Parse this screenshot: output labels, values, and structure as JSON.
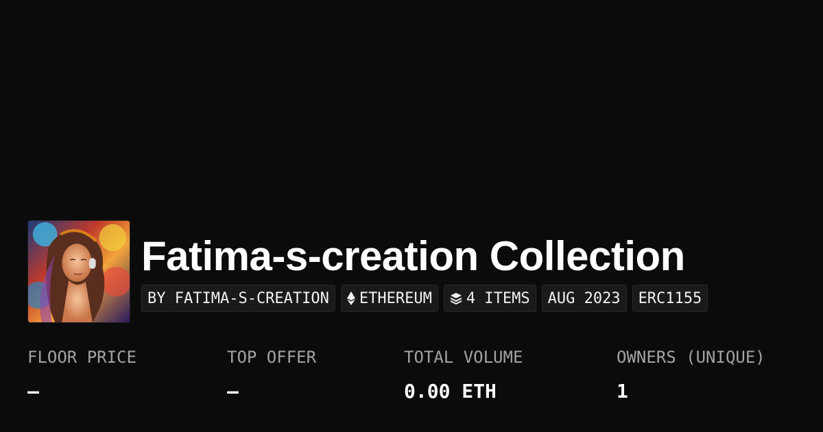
{
  "collection": {
    "title": "Fatima-s-creation Collection",
    "avatar_alt": "collection-avatar"
  },
  "badges": {
    "creator": "BY FATIMA-S-CREATION",
    "chain": "ETHEREUM",
    "chain_icon": "ethereum-icon",
    "items": "4 ITEMS",
    "items_icon": "layers-icon",
    "date": "AUG 2023",
    "standard": "ERC1155"
  },
  "stats": [
    {
      "label": "FLOOR PRICE",
      "value": "–"
    },
    {
      "label": "TOP OFFER",
      "value": "–"
    },
    {
      "label": "TOTAL VOLUME",
      "value": "0.00 ETH"
    },
    {
      "label": "OWNERS (UNIQUE)",
      "value": "1"
    }
  ],
  "colors": {
    "background": "#0b0b0b",
    "badge_background": "#1a1a1a",
    "label": "#a3a3a3",
    "text": "#ffffff"
  }
}
